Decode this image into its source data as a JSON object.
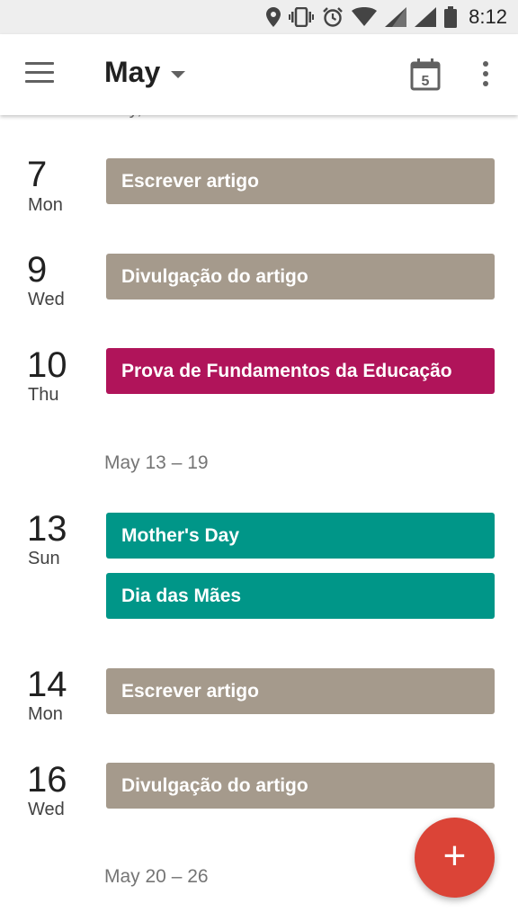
{
  "status_bar": {
    "time": "8:12"
  },
  "header": {
    "title": "May",
    "today_date": "5"
  },
  "cutoff_text": "May,",
  "days": [
    {
      "num": "7",
      "name": "Mon",
      "events": [
        {
          "title": "Escrever artigo",
          "color": "#a59a8c"
        }
      ]
    },
    {
      "num": "9",
      "name": "Wed",
      "events": [
        {
          "title": "Divulgação do artigo",
          "color": "#a59a8c"
        }
      ]
    },
    {
      "num": "10",
      "name": "Thu",
      "events": [
        {
          "title": "Prova de Fundamentos da Educação",
          "color": "#b0145a"
        }
      ]
    },
    {
      "num": "13",
      "name": "Sun",
      "events": [
        {
          "title": "Mother's Day",
          "color": "#009688"
        },
        {
          "title": "Dia das Mães",
          "color": "#009688"
        }
      ]
    },
    {
      "num": "14",
      "name": "Mon",
      "events": [
        {
          "title": "Escrever artigo",
          "color": "#a59a8c"
        }
      ]
    },
    {
      "num": "16",
      "name": "Wed",
      "events": [
        {
          "title": "Divulgação do artigo",
          "color": "#a59a8c"
        }
      ]
    }
  ],
  "week_labels": [
    "May 13 – 19",
    "May 20 – 26"
  ],
  "fab": {
    "icon": "plus-icon",
    "symbol": "+",
    "color": "#db4437"
  }
}
